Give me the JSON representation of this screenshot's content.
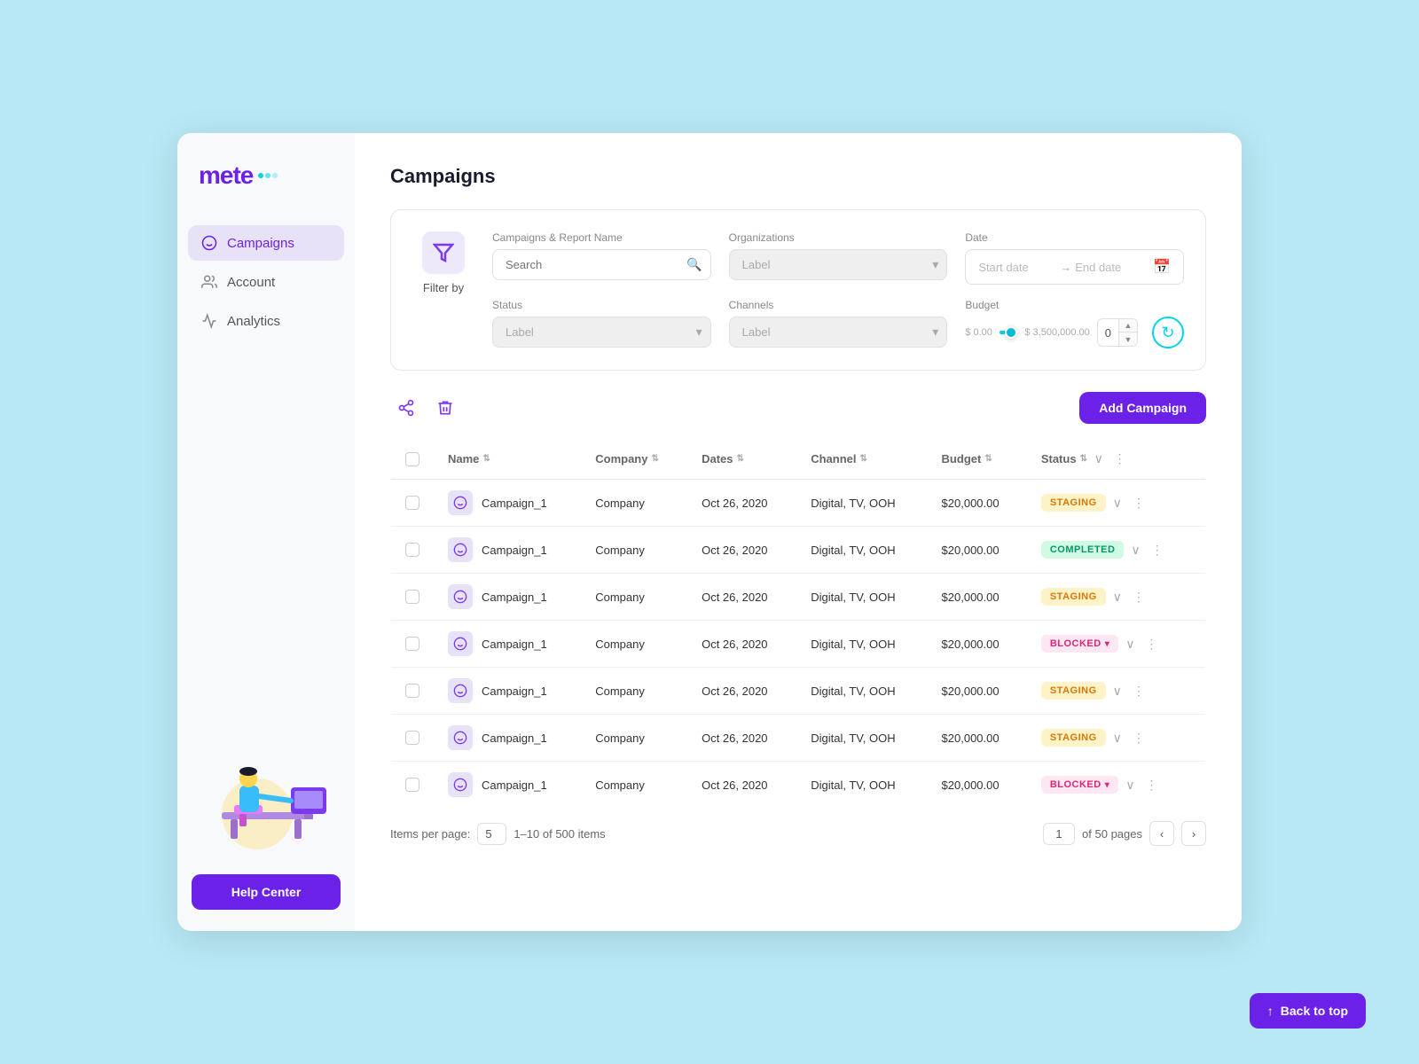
{
  "app": {
    "logo_text": "mete",
    "logo_dots": [
      "●",
      "●",
      "●"
    ]
  },
  "sidebar": {
    "nav_items": [
      {
        "id": "campaigns",
        "label": "Campaigns",
        "icon": "📊",
        "active": true
      },
      {
        "id": "account",
        "label": "Account",
        "icon": "👥",
        "active": false
      },
      {
        "id": "analytics",
        "label": "Analytics",
        "icon": "📈",
        "active": false
      }
    ],
    "help_center_label": "Help Center"
  },
  "page": {
    "title": "Campaigns"
  },
  "filter": {
    "title": "Filter by",
    "campaigns_report_label": "Campaigns & Report Name",
    "campaigns_placeholder": "Search",
    "organizations_label": "Organizations",
    "organizations_placeholder": "Label",
    "date_label": "Date",
    "date_start": "Start date",
    "date_end": "End date",
    "status_label": "Status",
    "status_placeholder": "Label",
    "channels_label": "Channels",
    "channels_placeholder": "Label",
    "budget_label": "Budget",
    "budget_min": "$ 0.00",
    "budget_max": "$ 3,500,000.00",
    "budget_value": "0"
  },
  "toolbar": {
    "add_campaign_label": "Add Campaign"
  },
  "table": {
    "columns": [
      "Name",
      "Company",
      "Dates",
      "Channel",
      "Budget",
      "Status"
    ],
    "rows": [
      {
        "name": "Campaign_1",
        "company": "Company",
        "dates": "Oct 26, 2020",
        "channel": "Digital, TV, OOH",
        "budget": "$20,000.00",
        "status": "STAGING",
        "status_type": "staging"
      },
      {
        "name": "Campaign_1",
        "company": "Company",
        "dates": "Oct 26, 2020",
        "channel": "Digital, TV, OOH",
        "budget": "$20,000.00",
        "status": "COMPLETED",
        "status_type": "completed"
      },
      {
        "name": "Campaign_1",
        "company": "Company",
        "dates": "Oct 26, 2020",
        "channel": "Digital, TV, OOH",
        "budget": "$20,000.00",
        "status": "STAGING",
        "status_type": "staging"
      },
      {
        "name": "Campaign_1",
        "company": "Company",
        "dates": "Oct 26, 2020",
        "channel": "Digital, TV, OOH",
        "budget": "$20,000.00",
        "status": "BLOCKED",
        "status_type": "blocked"
      },
      {
        "name": "Campaign_1",
        "company": "Company",
        "dates": "Oct 26, 2020",
        "channel": "Digital, TV, OOH",
        "budget": "$20,000.00",
        "status": "STAGING",
        "status_type": "staging"
      },
      {
        "name": "Campaign_1",
        "company": "Company",
        "dates": "Oct 26, 2020",
        "channel": "Digital, TV, OOH",
        "budget": "$20,000.00",
        "status": "STAGING",
        "status_type": "staging"
      },
      {
        "name": "Campaign_1",
        "company": "Company",
        "dates": "Oct 26, 2020",
        "channel": "Digital, TV, OOH",
        "budget": "$20,000.00",
        "status": "BLOCKED",
        "status_type": "blocked"
      }
    ]
  },
  "pagination": {
    "items_per_page_label": "Items per page:",
    "items_per_page_value": "5",
    "items_range": "1–10 of 500 items",
    "current_page": "1",
    "total_pages": "of 50 pages"
  },
  "back_to_top": {
    "label": "Back to top",
    "icon": "↑"
  }
}
